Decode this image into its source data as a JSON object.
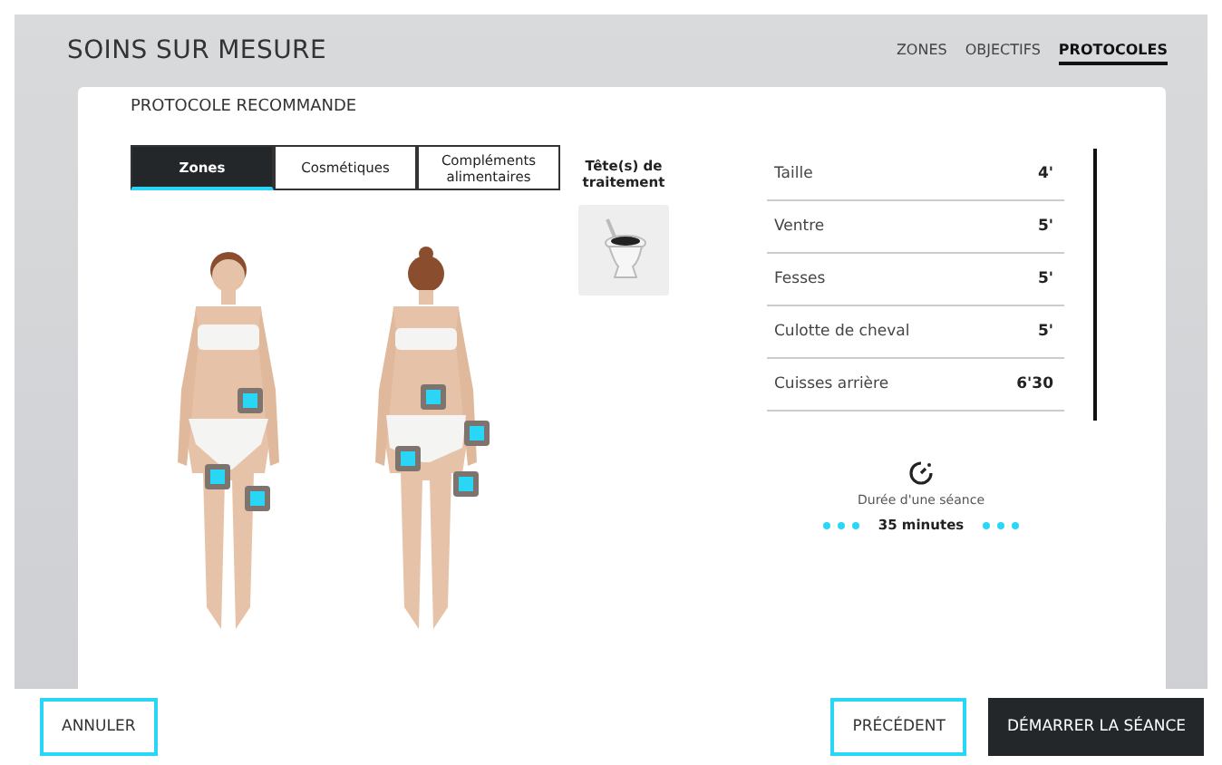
{
  "header": {
    "title": "SOINS SUR MESURE",
    "nav": [
      {
        "label": "ZONES",
        "selected": false
      },
      {
        "label": "OBJECTIFS",
        "selected": false
      },
      {
        "label": "PROTOCOLES",
        "selected": true
      }
    ]
  },
  "section_title": "PROTOCOLE RECOMMANDE",
  "tabs": [
    {
      "label": "Zones",
      "selected": true
    },
    {
      "label": "Cosmétiques",
      "selected": false
    },
    {
      "label": "Compléments alimentaires",
      "selected": false
    }
  ],
  "treatment_head": {
    "title": "Tête(s) de traitement"
  },
  "zones": [
    {
      "name": "Taille",
      "duration": "4'"
    },
    {
      "name": "Ventre",
      "duration": "5'"
    },
    {
      "name": "Fesses",
      "duration": "5'"
    },
    {
      "name": "Culotte de cheval",
      "duration": "5'"
    },
    {
      "name": "Cuisses arrière",
      "duration": "6'30"
    }
  ],
  "session": {
    "label": "Durée d'une séance",
    "value": "35 minutes"
  },
  "footer": {
    "cancel": "ANNULER",
    "previous": "PRÉCÉDENT",
    "start": "DÉMARRER LA SÉANCE"
  }
}
